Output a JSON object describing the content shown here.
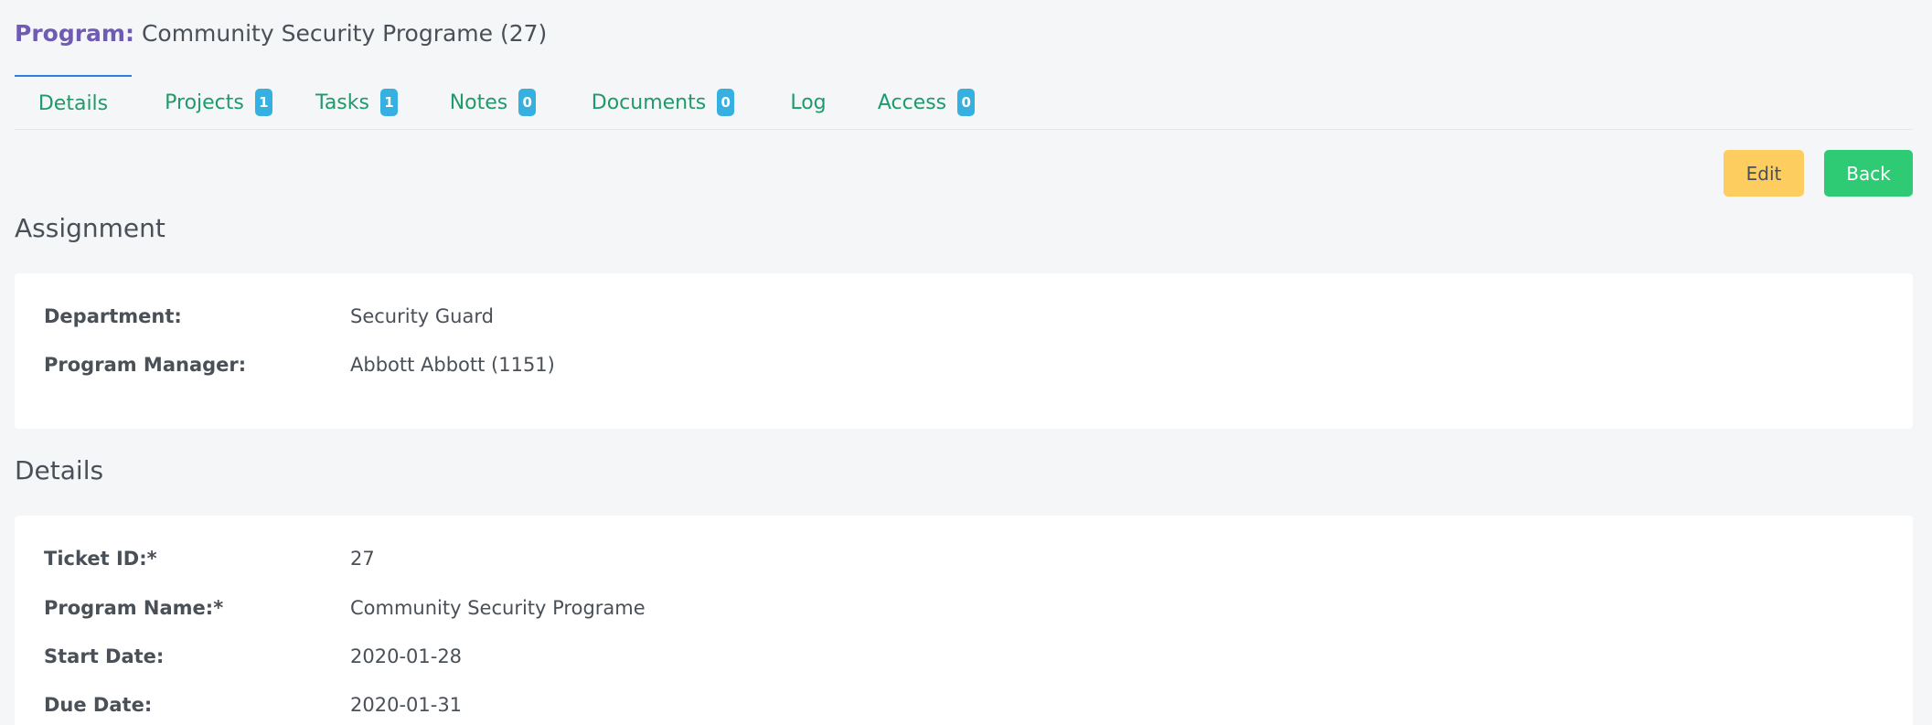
{
  "header": {
    "label": "Program:",
    "title": "Community Security Programe (27)"
  },
  "tabs": [
    {
      "label": "Details",
      "badge": ""
    },
    {
      "label": "Projects",
      "badge": "1"
    },
    {
      "label": "Tasks",
      "badge": "1"
    },
    {
      "label": "Notes",
      "badge": "0"
    },
    {
      "label": "Documents",
      "badge": "0"
    },
    {
      "label": "Log",
      "badge": ""
    },
    {
      "label": "Access",
      "badge": "0"
    }
  ],
  "actions": {
    "edit_label": "Edit",
    "back_label": "Back"
  },
  "assignment": {
    "title": "Assignment",
    "fields": [
      {
        "key": "Department:",
        "value": "Security Guard"
      },
      {
        "key": "Program Manager:",
        "value": "Abbott Abbott (1151)"
      }
    ]
  },
  "details": {
    "title": "Details",
    "fields": [
      {
        "key": "Ticket ID:*",
        "value": "27"
      },
      {
        "key": "Program Name:*",
        "value": "Community Security Programe"
      },
      {
        "key": "Start Date:",
        "value": "2020-01-28"
      },
      {
        "key": "Due Date:",
        "value": "2020-01-31"
      }
    ]
  },
  "colors": {
    "accent_purple": "#6f5bb1",
    "tab_green": "#1f9a6a",
    "badge_blue": "#36b0e0",
    "edit_yellow": "#fdcd5f",
    "back_green": "#2fca74"
  }
}
